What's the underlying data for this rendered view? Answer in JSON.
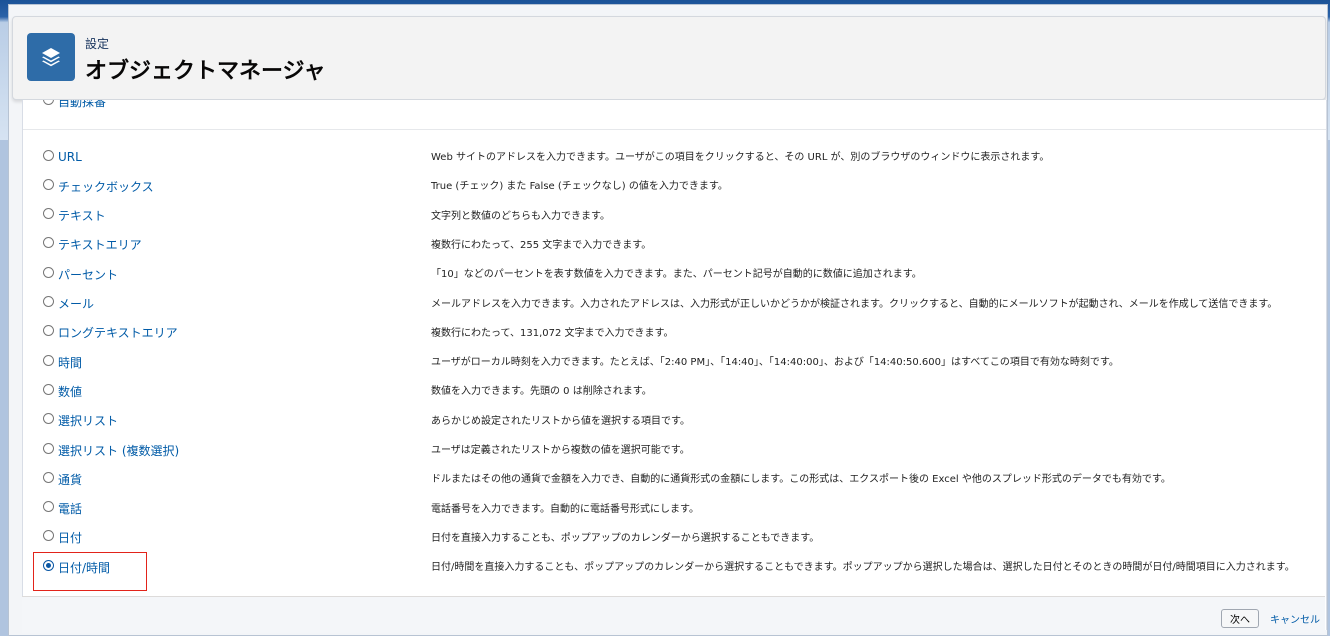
{
  "header": {
    "breadcrumb": "設定",
    "title": "オブジェクトマネージャ",
    "icon": "layers-icon"
  },
  "partial_row_label": "自動採番",
  "field_types": [
    {
      "label": "URL",
      "description": "Web サイトのアドレスを入力できます。ユーザがこの項目をクリックすると、その URL が、別のブラウザのウィンドウに表示されます。",
      "selected": false
    },
    {
      "label": "チェックボックス",
      "description": "True (チェック) また False (チェックなし) の値を入力できます。",
      "selected": false
    },
    {
      "label": "テキスト",
      "description": "文字列と数値のどちらも入力できます。",
      "selected": false
    },
    {
      "label": "テキストエリア",
      "description": "複数行にわたって、255 文字まで入力できます。",
      "selected": false
    },
    {
      "label": "パーセント",
      "description": "「10」などのパーセントを表す数値を入力できます。また、パーセント記号が自動的に数値に追加されます。",
      "selected": false
    },
    {
      "label": "メール",
      "description": "メールアドレスを入力できます。入力されたアドレスは、入力形式が正しいかどうかが検証されます。クリックすると、自動的にメールソフトが起動され、メールを作成して送信できます。",
      "selected": false
    },
    {
      "label": "ロングテキストエリア",
      "description": "複数行にわたって、131,072 文字まで入力できます。",
      "selected": false
    },
    {
      "label": "時間",
      "description": "ユーザがローカル時刻を入力できます。たとえば、「2:40 PM」、「14:40」、「14:40:00」、および「14:40:50.600」はすべてこの項目で有効な時刻です。",
      "selected": false
    },
    {
      "label": "数値",
      "description": "数値を入力できます。先頭の 0 は削除されます。",
      "selected": false
    },
    {
      "label": "選択リスト",
      "description": "あらかじめ設定されたリストから値を選択する項目です。",
      "selected": false
    },
    {
      "label": "選択リスト (複数選択)",
      "description": "ユーザは定義されたリストから複数の値を選択可能です。",
      "selected": false
    },
    {
      "label": "通貨",
      "description": "ドルまたはその他の通貨で金額を入力でき、自動的に通貨形式の金額にします。この形式は、エクスポート後の Excel や他のスプレッド形式のデータでも有効です。",
      "selected": false
    },
    {
      "label": "電話",
      "description": "電話番号を入力できます。自動的に電話番号形式にします。",
      "selected": false
    },
    {
      "label": "日付",
      "description": "日付を直接入力することも、ポップアップのカレンダーから選択することもできます。",
      "selected": false
    },
    {
      "label": "日付/時間",
      "description": "日付/時間を直接入力することも、ポップアップのカレンダーから選択することもできます。ポップアップから選択した場合は、選択した日付とそのときの時間が日付/時間項目に入力されます。",
      "selected": true
    }
  ],
  "footer": {
    "next_label": "次へ",
    "cancel_label": "キャンセル"
  },
  "colors": {
    "accent": "#015ba7",
    "highlight": "#e2231a",
    "icon_bg": "#2e6ca8"
  }
}
